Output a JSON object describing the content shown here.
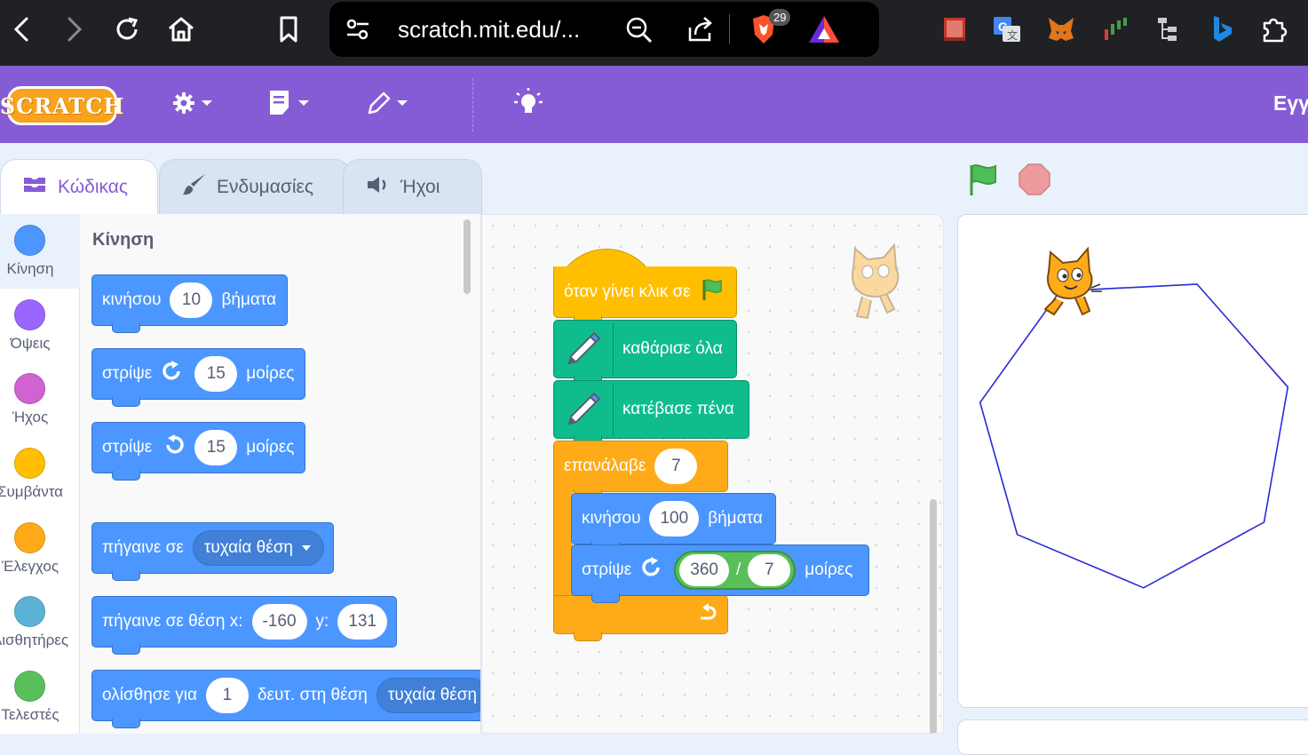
{
  "browser": {
    "url": "scratch.mit.edu/...",
    "brave_badge": "29"
  },
  "menu": {
    "logo": "SCRATCH",
    "right_text": "Εγγ"
  },
  "tabs": [
    {
      "label": "Κώδικας"
    },
    {
      "label": "Ενδυμασίες"
    },
    {
      "label": "Ήχοι"
    }
  ],
  "categories": [
    {
      "label": "Κίνηση",
      "color": "#4c97ff"
    },
    {
      "label": "Όψεις",
      "color": "#9966ff"
    },
    {
      "label": "Ήχος",
      "color": "#cf63cf"
    },
    {
      "label": "Συμβάντα",
      "color": "#ffbf00"
    },
    {
      "label": "Έλεγχος",
      "color": "#ffab19"
    },
    {
      "label": "Αισθητήρες",
      "color": "#5cb1d6"
    },
    {
      "label": "Τελεστές",
      "color": "#59c059"
    }
  ],
  "palette": {
    "title": "Κίνηση",
    "move": {
      "pre": "κινήσου",
      "value": "10",
      "post": "βήματα"
    },
    "turn_right": {
      "pre": "στρίψε",
      "value": "15",
      "post": "μοίρες"
    },
    "turn_left": {
      "pre": "στρίψε",
      "value": "15",
      "post": "μοίρες"
    },
    "goto": {
      "pre": "πήγαινε σε",
      "dropdown": "τυχαία θέση"
    },
    "goto_xy": {
      "pre": "πήγαινε σε θέση x:",
      "x": "-160",
      "mid": "y:",
      "y": "131"
    },
    "glide": {
      "pre": "ολίσθησε για",
      "value": "1",
      "mid": "δευτ. στη θέση",
      "dropdown": "τυχαία θέση"
    }
  },
  "script": {
    "hat": "όταν γίνει κλικ σε",
    "clear": "καθάρισε όλα",
    "pen_down": "κατέβασε πένα",
    "repeat": {
      "label": "επανάλαβε",
      "value": "7"
    },
    "move": {
      "pre": "κινήσου",
      "value": "100",
      "post": "βήματα"
    },
    "turn": {
      "pre": "στρίψε",
      "left": "360",
      "op": "/",
      "right": "7",
      "post": "μοίρες"
    }
  },
  "stage": {
    "pen_color": "#2a2ad6",
    "polygon_sides": 7,
    "step": 100,
    "turn_degrees": 51.43
  },
  "colors": {
    "menu": "#855cd6",
    "motion": "#4c97ff",
    "pen": "#0fbd8c",
    "events": "#ffbf00",
    "control": "#ffab19",
    "operators": "#59c059"
  }
}
